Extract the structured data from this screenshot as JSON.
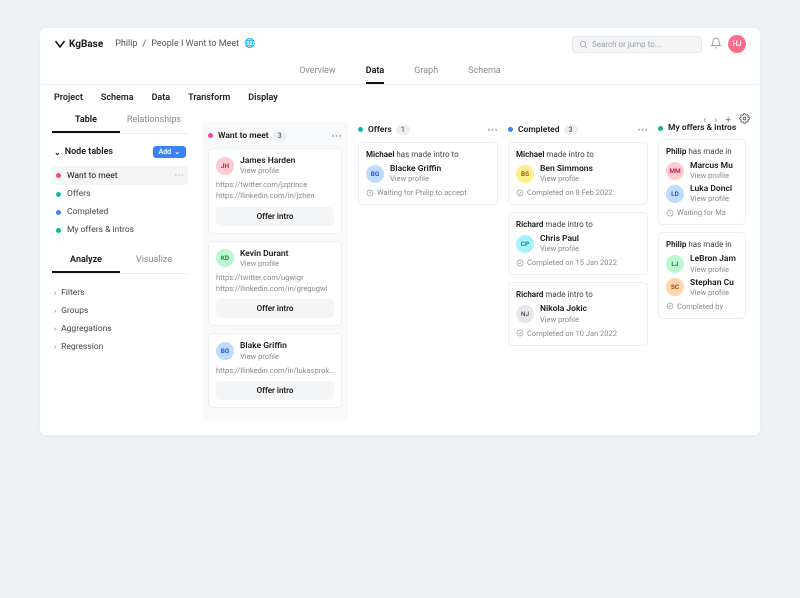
{
  "brand": "KgBase",
  "breadcrumb": {
    "owner": "Philip",
    "title": "People I Want to Meet"
  },
  "search_placeholder": "Search or jump to...",
  "user_initials": "HJ",
  "primary_tabs": {
    "overview": "Overview",
    "data": "Data",
    "graph": "Graph",
    "schema": "Schema"
  },
  "secondary_tabs": {
    "project": "Project",
    "schema": "Schema",
    "data": "Data",
    "transform": "Transform",
    "display": "Display"
  },
  "side_tabs": {
    "table": "Table",
    "relationships": "Relationships"
  },
  "node_header": "Node tables",
  "add_label": "Add",
  "nodes": {
    "want": "Want to meet",
    "offers": "Offers",
    "completed": "Completed",
    "mine": "My offers & intros"
  },
  "analyze_tabs": {
    "analyze": "Analyze",
    "visualize": "Visualize"
  },
  "tools": {
    "filters": "Filters",
    "groups": "Groups",
    "aggregations": "Aggregations",
    "regression": "Regression"
  },
  "columns": {
    "want": {
      "title": "Want to meet",
      "count": "3"
    },
    "offers": {
      "title": "Offers",
      "count": "1"
    },
    "completed": {
      "title": "Completed",
      "count": "3"
    },
    "mine": {
      "title": "My offers & intros"
    }
  },
  "labels": {
    "view_profile": "View profile",
    "offer_intro": "Offer intro"
  },
  "want_cards": [
    {
      "initials": "JH",
      "name": "James Harden",
      "links": [
        "https://twitter.com/jzprince",
        "https://llinkedin.com/in/jzhen"
      ]
    },
    {
      "initials": "KD",
      "name": "Kevin Durant",
      "links": [
        "https://twitter.com/ugwigr",
        "https://llinkedin.com/in/gregugwi"
      ]
    },
    {
      "initials": "BG",
      "name": "Blake Griffin",
      "links": [
        "https://llinkedin.com/in/lukasprok..."
      ]
    }
  ],
  "offers_cards": [
    {
      "intro_actor": "Michael",
      "intro_verb": "has made intro to",
      "initials": "BG",
      "name": "Blacke Griffin",
      "status": "Waiting for Philip to accept"
    }
  ],
  "completed_cards": [
    {
      "intro_actor": "Michael",
      "intro_verb": "made intro to",
      "initials": "BS",
      "name": "Ben Simmons",
      "status": "Completed on 8 Feb 2022"
    },
    {
      "intro_actor": "Richard",
      "intro_verb": "made intro to",
      "initials": "CP",
      "name": "Chris Paul",
      "status": "Completed on 15 Jan 2022"
    },
    {
      "intro_actor": "Richard",
      "intro_verb": "made intro to",
      "initials": "NJ",
      "name": "Nikola Jokic",
      "status": "Completed on 10 Jan 2022"
    }
  ],
  "mine_cards": [
    {
      "intro_actor": "Philip",
      "intro_verb": "has made in",
      "people": [
        {
          "i": "MM",
          "n": "Marcus Mu"
        },
        {
          "i": "LD",
          "n": "Luka Donci"
        }
      ],
      "status": "Waiting for Ma"
    },
    {
      "intro_actor": "Philip",
      "intro_verb": "has made in",
      "people": [
        {
          "i": "LJ",
          "n": "LeBron Jam"
        },
        {
          "i": "SC",
          "n": "Stephan Cu"
        }
      ],
      "status": "Completed by"
    }
  ]
}
